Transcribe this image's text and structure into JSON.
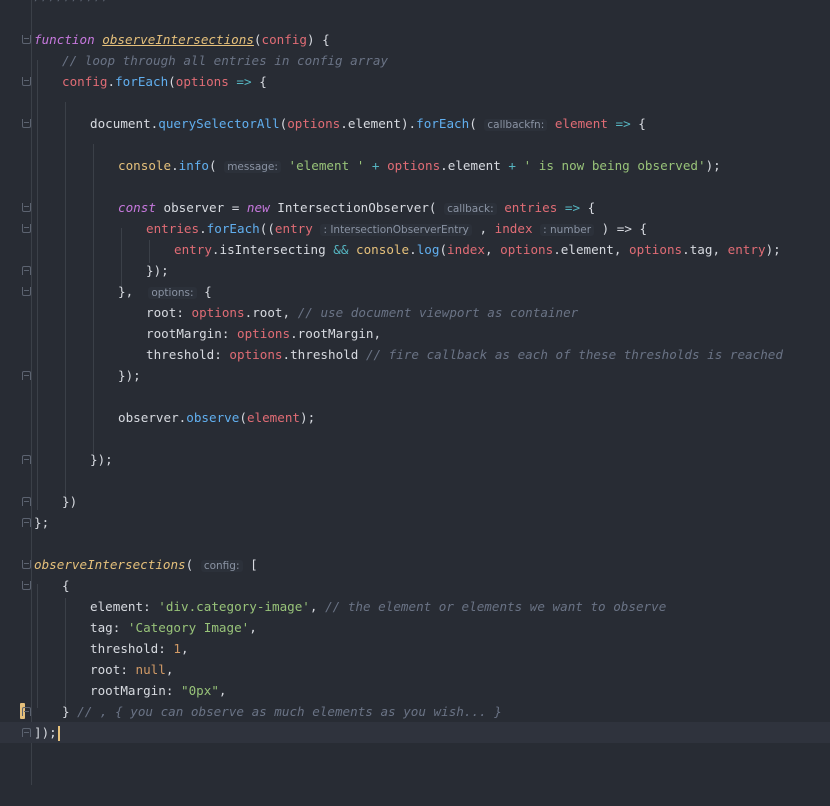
{
  "editor": {
    "theme": {
      "background": "#282c34",
      "keyword": "#c678dd",
      "function": "#61afef",
      "string": "#98c379",
      "number": "#d19a66",
      "comment": "#6a7385",
      "property": "#e06c75",
      "class": "#e5c07b",
      "operator": "#56b6c2"
    },
    "top_fragment": "//////////",
    "lines": {
      "l1": {
        "kw": "function",
        "name": "observeIntersections",
        "p1": "(",
        "param": "config",
        "p2": ") {"
      },
      "l2": {
        "comment": "// loop through all entries in config array"
      },
      "l3": {
        "obj": "config",
        "dot": ".",
        "fn": "forEach",
        "open": "(",
        "param": "options",
        "arrow": " => ",
        "brace": "{"
      },
      "l5": {
        "obj": "document",
        "dot": ".",
        "fn": "querySelectorAll",
        "open": "(",
        "param": "options",
        "dot2": ".",
        "prop": "element",
        "close": ").",
        "fn2": "forEach",
        "open2": "( ",
        "hint": "callbackfn:",
        "param2": "element",
        "arrow": " => ",
        "brace": "{"
      },
      "l7": {
        "obj": "console",
        "dot": ".",
        "fn": "info",
        "open": "( ",
        "hint": "message:",
        "str1": "'element '",
        "plus1": " + ",
        "param": "options",
        "dot2": ".",
        "prop": "element",
        "plus2": " + ",
        "str2": "' is now being observed'",
        "close": ");"
      },
      "l9": {
        "kw": "const",
        "var": " observer = ",
        "kw2": "new",
        "cls": " IntersectionObserver",
        "open": "( ",
        "hint": "callback:",
        "param": "entries",
        "arrow": " => ",
        "brace": "{"
      },
      "l10": {
        "param": "entries",
        "dot": ".",
        "fn": "forEach",
        "open": "((",
        "param2": "entry",
        "hint1": ": IntersectionObserverEntry",
        "comma": " , ",
        "param3": "index",
        "hint2": ": number",
        "close": " ) => {"
      },
      "l11": {
        "param": "entry",
        "dot": ".",
        "prop": "isIntersecting",
        "op": " && ",
        "obj": "console",
        "dot2": ".",
        "fn": "log",
        "open": "(",
        "a1": "index",
        "c1": ", ",
        "a2": "options",
        "d2": ".",
        "a2p": "element",
        "c2": ", ",
        "a3": "options",
        "d3": ".",
        "a3p": "tag",
        "c3": ", ",
        "a4": "entry",
        "close": ");"
      },
      "l12": {
        "text": "});"
      },
      "l13": {
        "text": "},",
        "hint": "options:",
        "brace": " {"
      },
      "l14": {
        "key": "root",
        "colon": ": ",
        "param": "options",
        "dot": ".",
        "prop": "root",
        "comma": ", ",
        "comment": "// use document viewport as container"
      },
      "l15": {
        "key": "rootMargin",
        "colon": ": ",
        "param": "options",
        "dot": ".",
        "prop": "rootMargin",
        "comma": ","
      },
      "l16": {
        "key": "threshold",
        "colon": ": ",
        "param": "options",
        "dot": ".",
        "prop": "threshold",
        "space": " ",
        "comment": "// fire callback as each of these thresholds is reached"
      },
      "l17": {
        "text": "});"
      },
      "l19": {
        "param": "observer",
        "dot": ".",
        "fn": "observe",
        "open": "(",
        "arg": "element",
        "close": ");"
      },
      "l21": {
        "text": "});"
      },
      "l23": {
        "text": "})"
      },
      "l24": {
        "text": "};"
      },
      "l26": {
        "name": "observeIntersections",
        "open": "( ",
        "hint": "config:",
        "bracket": " ["
      },
      "l27": {
        "text": "{"
      },
      "l28": {
        "key": "element",
        "colon": ": ",
        "str": "'div.category-image'",
        "comma": ", ",
        "comment": "// the element or elements we want to observe"
      },
      "l29": {
        "key": "tag",
        "colon": ": ",
        "str": "'Category Image'",
        "comma": ","
      },
      "l30": {
        "key": "threshold",
        "colon": ": ",
        "num": "1",
        "comma": ","
      },
      "l31": {
        "key": "root",
        "colon": ": ",
        "kw": "null",
        "comma": ","
      },
      "l32": {
        "key": "rootMargin",
        "colon": ": ",
        "str": "\"0px\"",
        "comma": ","
      },
      "l33": {
        "text": "}",
        "comment": " // , { you can observe as much elements as you wish... }"
      },
      "l34": {
        "text": "]);"
      }
    }
  }
}
